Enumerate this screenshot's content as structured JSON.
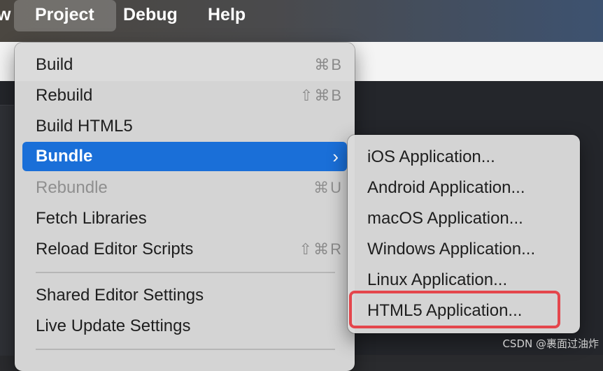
{
  "menubar": {
    "items": [
      {
        "label": "w"
      },
      {
        "label": "Project"
      },
      {
        "label": "Debug"
      },
      {
        "label": "Help"
      }
    ]
  },
  "project_menu": {
    "items": [
      {
        "label": "Build",
        "shortcut": "⌘B"
      },
      {
        "label": "Rebuild",
        "shortcut": "⇧⌘B"
      },
      {
        "label": "Build HTML5",
        "shortcut": ""
      },
      {
        "label": "Bundle",
        "submenu_icon": "chevron-right-icon",
        "chevron": "›"
      },
      {
        "label": "Rebundle",
        "shortcut": "⌘U",
        "disabled": true
      },
      {
        "label": "Fetch Libraries",
        "shortcut": ""
      },
      {
        "label": "Reload Editor Scripts",
        "shortcut": "⇧⌘R"
      },
      {
        "label": "Shared Editor Settings",
        "shortcut": ""
      },
      {
        "label": "Live Update Settings",
        "shortcut": ""
      }
    ]
  },
  "bundle_submenu": {
    "items": [
      {
        "label": "iOS Application..."
      },
      {
        "label": "Android Application..."
      },
      {
        "label": "macOS Application..."
      },
      {
        "label": "Windows Application..."
      },
      {
        "label": "Linux Application..."
      },
      {
        "label": "HTML5 Application..."
      }
    ]
  },
  "watermark": "CSDN @裹面过油炸",
  "colors": {
    "highlight": "#1a6fd8",
    "annotation": "#e4464c",
    "menu_bg": "#dadada"
  }
}
